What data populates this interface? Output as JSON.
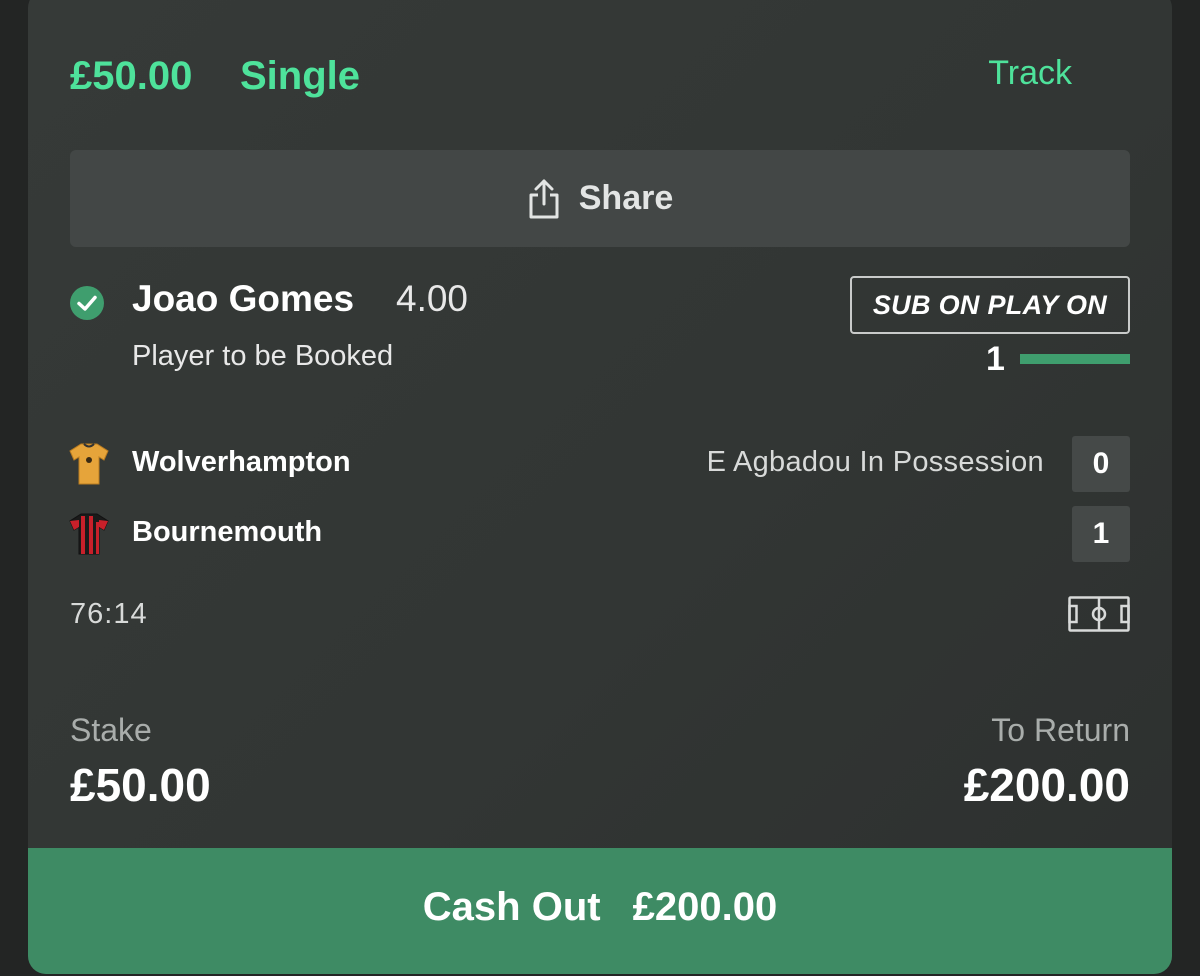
{
  "bet": {
    "amount": "£50.00",
    "type": "Single",
    "track_label": "Track"
  },
  "share": {
    "label": "Share",
    "icon": "share-icon"
  },
  "selection": {
    "status_icon": "check-circle-icon",
    "name": "Joao Gomes",
    "odds": "4.00",
    "market": "Player to be Booked"
  },
  "promo": {
    "badge": "SUB ON PLAY ON",
    "progress_count": "1",
    "progress_fraction": 1
  },
  "match": {
    "home": {
      "name": "Wolverhampton",
      "kit_icon": "wolves-kit-icon",
      "score": "0",
      "status": "E Agbadou In Possession"
    },
    "away": {
      "name": "Bournemouth",
      "kit_icon": "bournemouth-kit-icon",
      "score": "1"
    },
    "clock": "76:14",
    "pitch_icon": "pitch-icon"
  },
  "summary": {
    "stake_label": "Stake",
    "stake_value": "£50.00",
    "return_label": "To Return",
    "return_value": "£200.00"
  },
  "cashout": {
    "label": "Cash Out",
    "amount": "£200.00"
  },
  "colors": {
    "accent_green": "#4ee29b",
    "cashout_green": "#3e8b64",
    "card_bg": "#363a38"
  }
}
